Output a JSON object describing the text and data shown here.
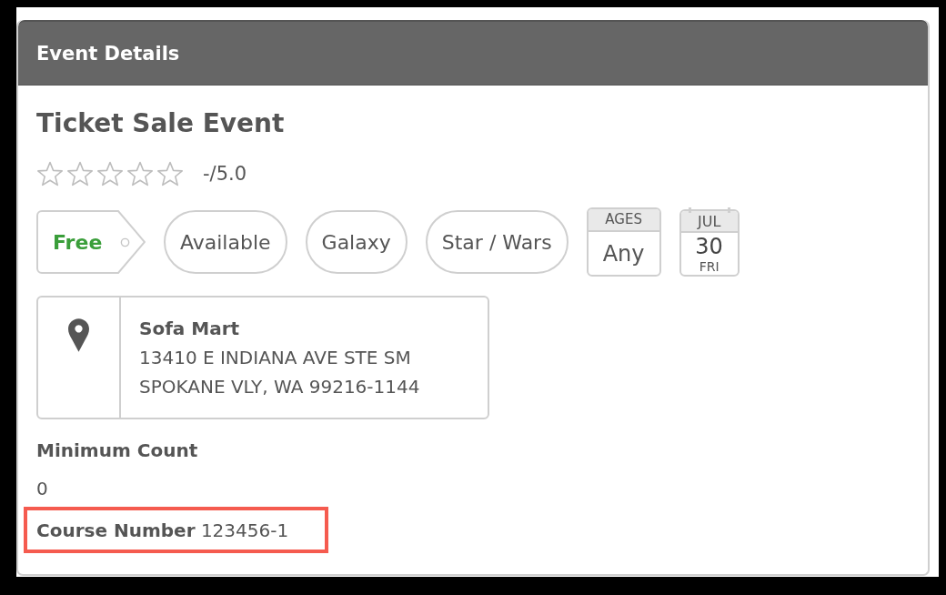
{
  "panel": {
    "title": "Event Details"
  },
  "event": {
    "title": "Ticket Sale Event",
    "rating": {
      "stars": 0,
      "text": "-/5.0"
    }
  },
  "tags": [
    {
      "kind": "price",
      "label": "Free"
    },
    {
      "kind": "pill",
      "label": "Available"
    },
    {
      "kind": "pill",
      "label": "Galaxy"
    },
    {
      "kind": "pill",
      "label": "Star / Wars"
    }
  ],
  "ages": {
    "heading": "AGES",
    "value": "Any"
  },
  "date": {
    "month": "JUL",
    "day": "30",
    "weekday": "FRI"
  },
  "location": {
    "name": "Sofa Mart",
    "address_lines": [
      "13410 E INDIANA AVE STE SM",
      "SPOKANE VLY, WA 99216-1144"
    ]
  },
  "fields": [
    {
      "kind": "stacked",
      "label": "Minimum Count",
      "value": "0",
      "highlighted": false
    },
    {
      "kind": "inline",
      "label": "Course Number",
      "value": "123456-1",
      "highlighted": true
    }
  ]
}
